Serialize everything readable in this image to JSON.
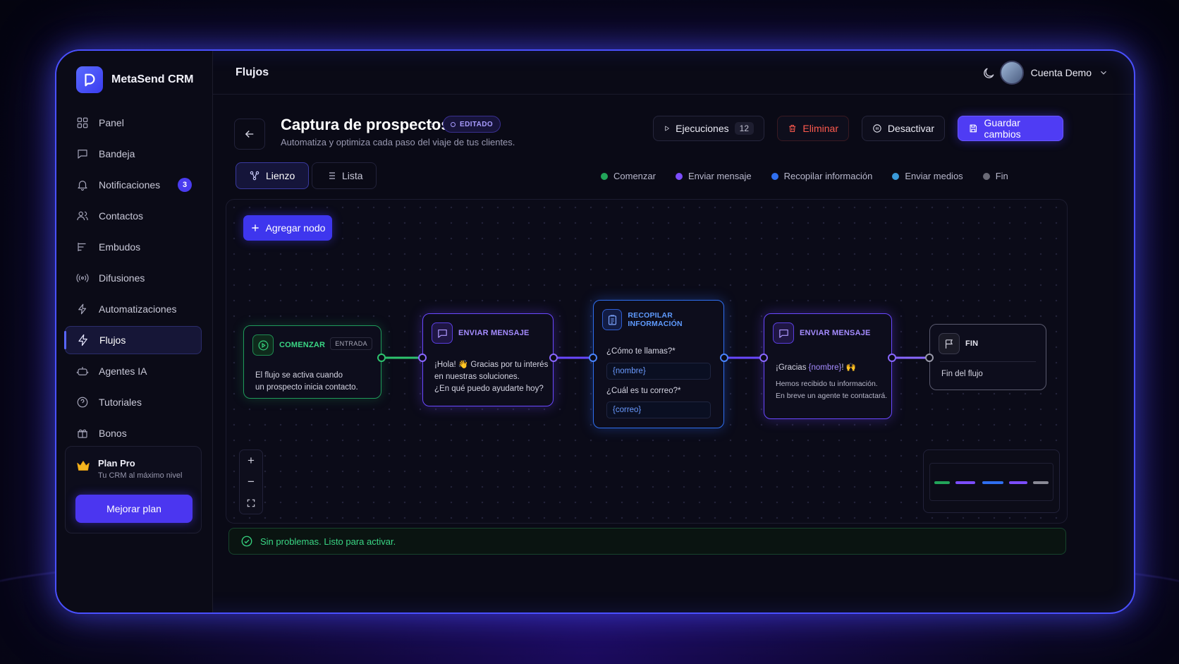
{
  "brand": {
    "name": "MetaSend CRM"
  },
  "sidebar": {
    "items": [
      {
        "label": "Panel",
        "icon": "grid-icon"
      },
      {
        "label": "Bandeja",
        "icon": "chat-icon"
      },
      {
        "label": "Notificaciones",
        "icon": "bell-icon",
        "badge": "3"
      },
      {
        "label": "Contactos",
        "icon": "users-icon"
      },
      {
        "label": "Embudos",
        "icon": "funnel-icon"
      },
      {
        "label": "Difusiones",
        "icon": "broadcast-icon"
      },
      {
        "label": "Automatizaciones",
        "icon": "automation-icon"
      },
      {
        "label": "Flujos",
        "icon": "bolt-icon",
        "active": true
      },
      {
        "label": "Agentes IA",
        "icon": "robot-icon"
      },
      {
        "label": "Tutoriales",
        "icon": "help-icon"
      },
      {
        "label": "Bonos",
        "icon": "gift-icon"
      }
    ],
    "plan": {
      "title": "Plan Pro",
      "subtitle": "Tu CRM al máximo nivel",
      "button": "Mejorar plan"
    }
  },
  "header": {
    "title": "Flujos",
    "account": "Cuenta Demo"
  },
  "flow": {
    "title": "Captura de prospectos",
    "status": "EDITADO",
    "subtitle": "Automatiza y optimiza cada paso del viaje de tus clientes.",
    "actions": {
      "executions": "Ejecuciones",
      "executions_count": "12",
      "delete": "Eliminar",
      "deactivate": "Desactivar",
      "save": "Guardar cambios"
    }
  },
  "tabs": {
    "canvas": "Lienzo",
    "list": "Lista"
  },
  "legend": [
    {
      "label": "Comenzar",
      "color": "#22a55a"
    },
    {
      "label": "Enviar mensaje",
      "color": "#7c4dff"
    },
    {
      "label": "Recopilar información",
      "color": "#2f6ff0"
    },
    {
      "label": "Enviar medios",
      "color": "#3a9ad9"
    },
    {
      "label": "Fin",
      "color": "#6a6a76"
    }
  ],
  "canvas": {
    "add_node": "Agregar nodo",
    "nodes": {
      "start": {
        "label": "COMENZAR",
        "tag": "ENTRADA",
        "line1": "El flujo se activa cuando",
        "line2": "un prospecto inicia contacto."
      },
      "msg1": {
        "label": "ENVIAR MENSAJE",
        "line1": "¡Hola! 👋 Gracias por tu interés",
        "line2": "en nuestras soluciones.",
        "line3": "¿En qué puedo ayudarte hoy?"
      },
      "info": {
        "label": "RECOPILAR INFORMACIÓN",
        "q1": "¿Cómo te llamas?*",
        "v1": "{nombre}",
        "q2": "¿Cuál es tu correo?*",
        "v2": "{correo}"
      },
      "msg2": {
        "label": "ENVIAR MENSAJE",
        "line1_pre": "¡Gracias ",
        "line1_var": "{nombre}",
        "line1_post": "! 🙌",
        "line2": "Hemos recibido tu información.",
        "line3": "En breve un agente te contactará."
      },
      "end": {
        "label": "FIN",
        "body": "Fin del flujo"
      }
    }
  },
  "status": {
    "message": "Sin problemas. Listo para activar."
  }
}
